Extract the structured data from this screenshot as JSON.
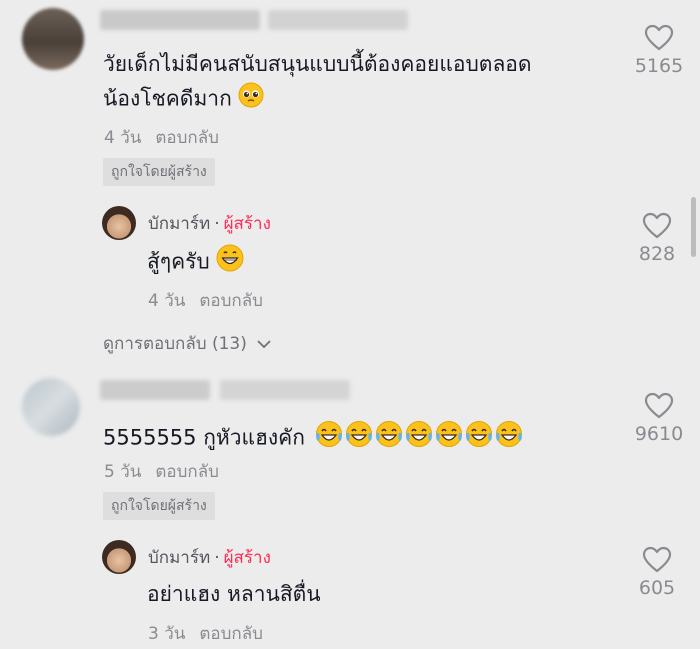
{
  "comments": [
    {
      "text": "วัยเด็กไม่มีคนสนับสนุนแบบนี้ต้องคอยแอบตลอด",
      "text_line2": "น้องโชคดีมาก",
      "line2_emoji": "pleading-face-emoji",
      "time": "4 วัน",
      "reply_label": "ตอบกลับ",
      "badge": "ถูกใจโดยผู้สร้าง",
      "likes": "5165",
      "reply": {
        "author": "บักมาร์ท",
        "separator": "·",
        "creator_tag": "ผู้สร้าง",
        "text": "สู้ๆครับ",
        "emoji": "grinning-face-emoji",
        "time": "4 วัน",
        "reply_label": "ตอบกลับ",
        "likes": "828"
      },
      "view_replies": "ดูการตอบกลับ (13)"
    },
    {
      "text": "5555555 กูหัวแฮงคัก",
      "emoji": "tears-of-joy-emoji",
      "emoji_count": 7,
      "time": "5 วัน",
      "reply_label": "ตอบกลับ",
      "badge": "ถูกใจโดยผู้สร้าง",
      "likes": "9610",
      "reply": {
        "author": "บักมาร์ท",
        "separator": "·",
        "creator_tag": "ผู้สร้าง",
        "text": "อย่าแฮง หลานสิตื่น",
        "time": "3 วัน",
        "reply_label": "ตอบกลับ",
        "likes": "605"
      }
    }
  ],
  "icons": {
    "like": "heart-outline-icon",
    "expand": "chevron-down-icon"
  },
  "colors": {
    "creator_tag": "#fe2c55",
    "secondary_text": "#8a8b91",
    "background": "#ececec"
  }
}
